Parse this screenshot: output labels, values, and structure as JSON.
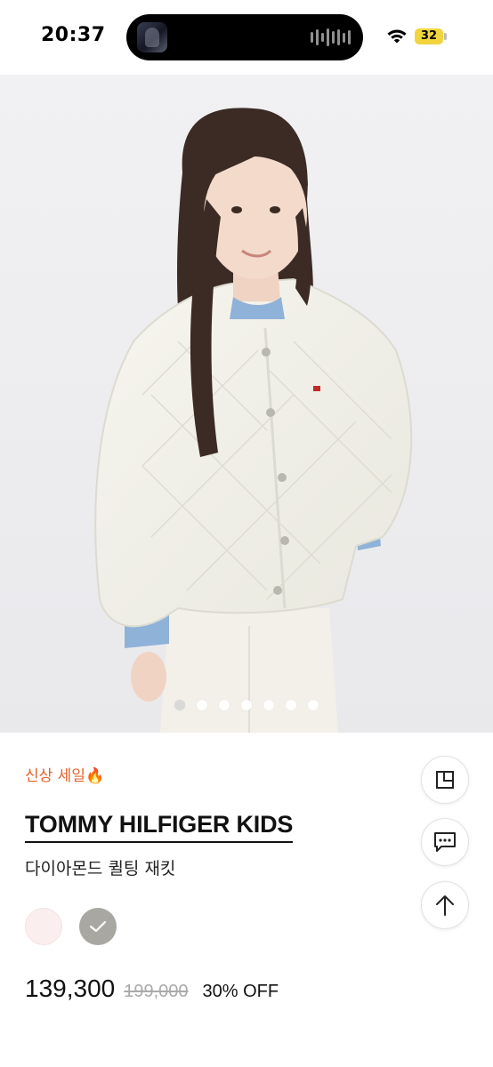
{
  "status_bar": {
    "time": "20:37",
    "battery": "32",
    "icons": [
      "album-art-icon",
      "audio-wave-icon",
      "wifi-icon",
      "battery-icon"
    ]
  },
  "hero": {
    "alt": "product-photo",
    "slide_count": 7,
    "active_slide": 1
  },
  "product": {
    "badge": "신상 세일🔥",
    "brand": "TOMMY HILFIGER KIDS",
    "name": "다이아몬드 퀼팅 재킷",
    "colors": [
      {
        "hex": "#fbeeee",
        "selected": false
      },
      {
        "hex": "#a9a7a2",
        "selected": true
      }
    ],
    "price": "139,300",
    "original_price": "199,000",
    "discount": "30% OFF"
  },
  "side_actions": [
    "recent-view-icon",
    "chat-icon",
    "scroll-top-icon"
  ],
  "colors": {
    "accent": "#e2632c",
    "island": "#000000",
    "battery": "#f2d43c"
  }
}
